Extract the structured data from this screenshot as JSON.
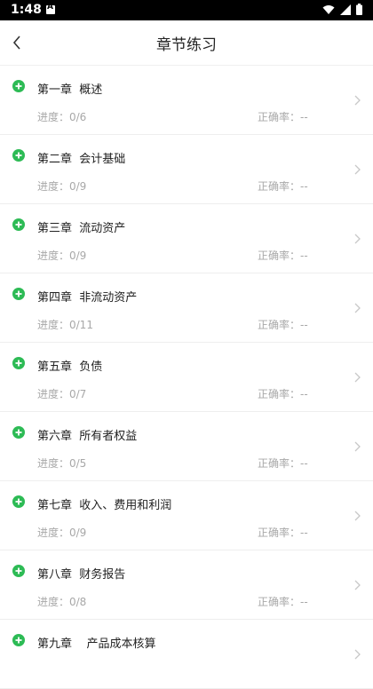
{
  "status_bar": {
    "time": "1:48"
  },
  "header": {
    "title": "章节练习"
  },
  "colors": {
    "accent": "#2dbb55"
  },
  "chapters": [
    {
      "title": "第一章  概述",
      "progress": "进度：0/6",
      "accuracy": "正确率：--"
    },
    {
      "title": "第二章  会计基础",
      "progress": "进度：0/9",
      "accuracy": "正确率：--"
    },
    {
      "title": "第三章  流动资产",
      "progress": "进度：0/9",
      "accuracy": "正确率：--"
    },
    {
      "title": "第四章  非流动资产",
      "progress": "进度：0/11",
      "accuracy": "正确率：--"
    },
    {
      "title": "第五章  负债",
      "progress": "进度：0/7",
      "accuracy": "正确率：--"
    },
    {
      "title": "第六章  所有者权益",
      "progress": "进度：0/5",
      "accuracy": "正确率：--"
    },
    {
      "title": "第七章  收入、费用和利润",
      "progress": "进度：0/9",
      "accuracy": "正确率：--"
    },
    {
      "title": "第八章  财务报告",
      "progress": "进度：0/8",
      "accuracy": "正确率：--"
    },
    {
      "title": "第九章    产品成本核算",
      "progress": "",
      "accuracy": ""
    }
  ]
}
